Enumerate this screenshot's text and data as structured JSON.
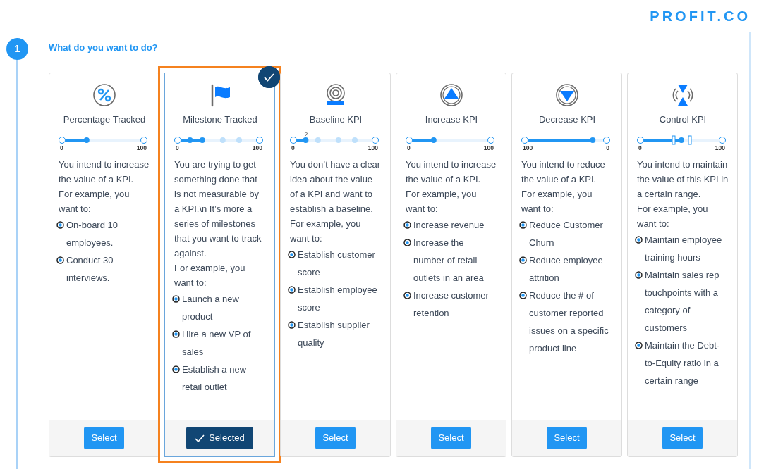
{
  "logo": "PROFIT.CO",
  "step": {
    "number": "1",
    "title": "What do you want to do?"
  },
  "options": [
    {
      "title": "Percentage Tracked",
      "selected": false,
      "scale": {
        "kind": "progress",
        "start": "0",
        "end": "100",
        "level": 0.3
      },
      "description": "You intend to increase the value of a KPI.",
      "example_intro": "For example, you want to:",
      "examples": [
        "On-board 10 employees.",
        "Conduct 30 interviews."
      ],
      "button": "Select"
    },
    {
      "title": "Milestone Tracked",
      "selected": true,
      "scale": {
        "kind": "milestones",
        "start": "0",
        "end": "100",
        "level": 0.3
      },
      "description": "You are trying to get something done that is not measurable by a KPI.\\n It’s more a series of milestones that you want to track against.",
      "example_intro": "For example, you want to:",
      "examples": [
        "Launch a new product",
        "Hire a new VP of sales",
        "Establish a new retail outlet"
      ],
      "button": "Selected"
    },
    {
      "title": "Baseline KPI",
      "selected": false,
      "scale": {
        "kind": "baseline",
        "start": "0",
        "end": "100",
        "marker": "?",
        "level": 0.15
      },
      "description": "You don’t have a clear idea about the value of a KPI and want to establish a baseline.",
      "example_intro": "For example, you want to:",
      "examples": [
        "Establish customer score",
        "Establish employee score",
        "Establish supplier quality"
      ],
      "button": "Select"
    },
    {
      "title": "Increase KPI",
      "selected": false,
      "scale": {
        "kind": "progress",
        "start": "0",
        "end": "100",
        "level": 0.3
      },
      "description": "You intend to increase the value of a KPI.",
      "example_intro": "For example, you want to:",
      "examples": [
        "Increase revenue",
        "Increase the number of retail outlets in an area",
        "Increase customer retention"
      ],
      "button": "Select"
    },
    {
      "title": "Decrease KPI",
      "selected": false,
      "scale": {
        "kind": "progress",
        "start": "100",
        "end": "0",
        "level": 0.83
      },
      "description": "You intend to reduce the value of a KPI.",
      "example_intro": "For example, you want to:",
      "examples": [
        "Reduce Customer Churn",
        "Reduce employee attrition",
        "Reduce the # of customer reported issues on a specific product line"
      ],
      "button": "Select"
    },
    {
      "title": "Control KPI",
      "selected": false,
      "scale": {
        "kind": "range",
        "start": "0",
        "end": "100",
        "level": 0.5
      },
      "description": "You intend to maintain the value of this KPI in a certain range.",
      "example_intro": "For example, you want to:",
      "examples": [
        "Maintain employee training hours",
        "Maintain sales rep touchpoints with a category of customers",
        "Maintain the Debt-to-Equity ratio in a certain range"
      ],
      "button": "Select"
    }
  ]
}
